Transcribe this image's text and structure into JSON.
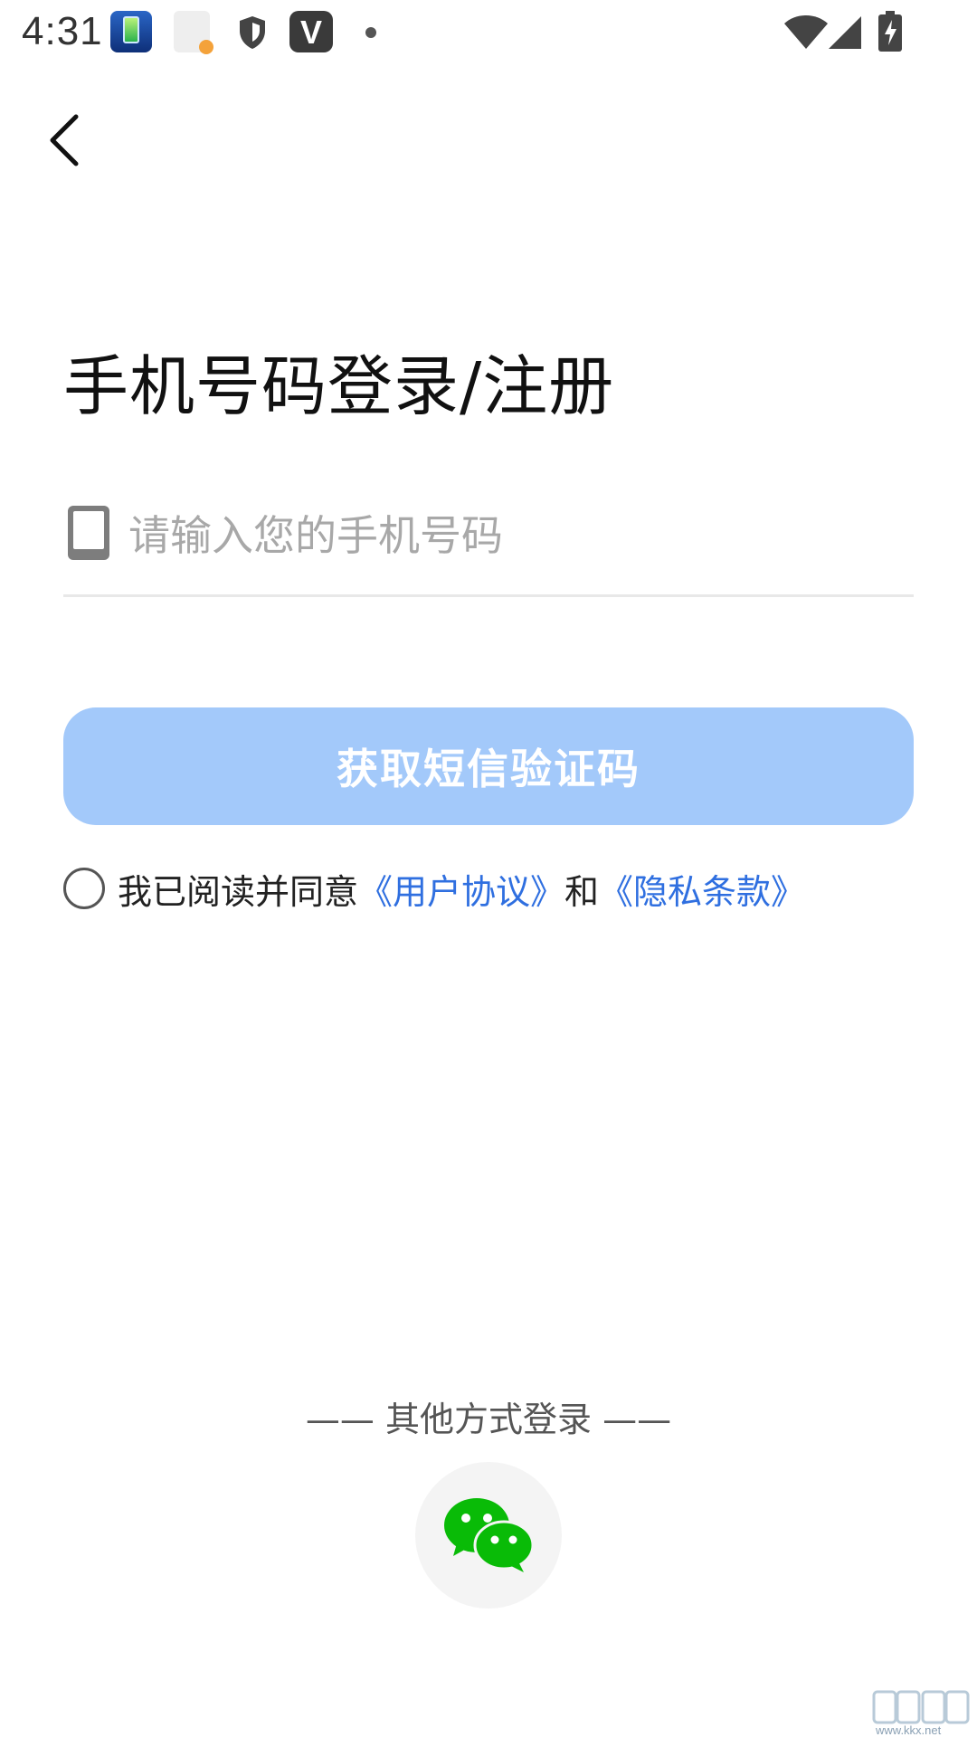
{
  "status_bar": {
    "time": "4:31",
    "icons": [
      "battery-app-icon",
      "app-notification-icon",
      "shield-icon",
      "v-app-icon",
      "dot-icon",
      "wifi-icon",
      "signal-icon",
      "battery-charging-icon"
    ],
    "v_app_letter": "V"
  },
  "nav": {
    "back_icon": "chevron-left-icon"
  },
  "login": {
    "title": "手机号码登录/注册",
    "phone_icon": "phone-icon",
    "phone_placeholder": "请输入您的手机号码",
    "phone_value": "",
    "sms_button_label": "获取短信验证码",
    "sms_button_color": "#a3c9fa"
  },
  "agreement": {
    "checked": false,
    "prefix": "我已阅读并同意",
    "user_agreement_link": "《用户协议》",
    "conjunction": "和",
    "privacy_link": "《隐私条款》",
    "link_color": "#2f6fe0"
  },
  "other_login": {
    "label": "—— 其他方式登录 ——",
    "wechat_icon": "wechat-icon",
    "wechat_color": "#09bb07"
  },
  "watermark": {
    "text": "www.kkx.net"
  }
}
